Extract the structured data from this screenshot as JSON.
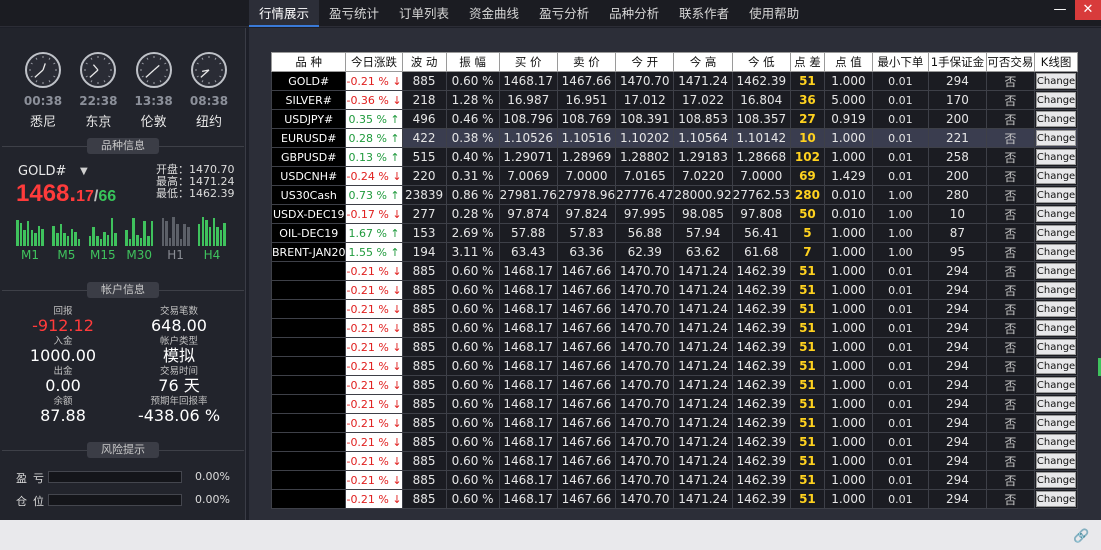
{
  "tabs": [
    {
      "label": "行情展示",
      "active": true
    },
    {
      "label": "盈亏统计"
    },
    {
      "label": "订单列表"
    },
    {
      "label": "资金曲线"
    },
    {
      "label": "盈亏分析"
    },
    {
      "label": "品种分析"
    },
    {
      "label": "联系作者"
    },
    {
      "label": "使用帮助"
    }
  ],
  "window": {
    "minimize": "—",
    "close": "✕"
  },
  "clocks": [
    {
      "time": "00:38",
      "city": "悉尼",
      "h": 0,
      "m": 38
    },
    {
      "time": "22:38",
      "city": "东京",
      "h": 22,
      "m": 38
    },
    {
      "time": "13:38",
      "city": "伦敦",
      "h": 13,
      "m": 38
    },
    {
      "time": "08:38",
      "city": "纽约",
      "h": 8,
      "m": 38
    }
  ],
  "sections": {
    "symbol_info": "品种信息",
    "account_info": "帐户信息",
    "risk": "风险提示"
  },
  "symbol": {
    "name": "GOLD#",
    "price_main": "1468.",
    "price_frac": "17",
    "price_sep": "/",
    "price_tail": "66",
    "open": "开盘：1470.70",
    "high": "最高：1471.24",
    "low": "最低：1462.39"
  },
  "timeframes": [
    {
      "label": "M1",
      "active": true
    },
    {
      "label": "M5",
      "active": true
    },
    {
      "label": "M15",
      "active": true
    },
    {
      "label": "M30",
      "active": true
    },
    {
      "label": "H1",
      "active": false
    },
    {
      "label": "H4",
      "active": true
    }
  ],
  "account": {
    "profit": {
      "label": "回报",
      "value": "-912.12"
    },
    "trades": {
      "label": "交易笔数",
      "value": "648.00"
    },
    "deposit": {
      "label": "入金",
      "value": "1000.00"
    },
    "acctype": {
      "label": "帐户类型",
      "value": "模拟"
    },
    "withdraw": {
      "label": "出金",
      "value": "0.00"
    },
    "tradetime": {
      "label": "交易时间",
      "value": "76 天"
    },
    "balance": {
      "label": "余额",
      "value": "87.88"
    },
    "annual": {
      "label": "预期年回报率",
      "value": "-438.06 %"
    }
  },
  "risk": [
    {
      "label": "盈亏",
      "value": "0.00%"
    },
    {
      "label": "仓位",
      "value": "0.00%"
    }
  ],
  "table": {
    "headers": [
      "品 种",
      "今日涨跌",
      "波 动",
      "振 幅",
      "买 价",
      "卖 价",
      "今 开",
      "今 高",
      "今 低",
      "点 差",
      "点 值",
      "最小下单",
      "1手保证金",
      "可否交易",
      "K线图"
    ],
    "button_label": "Change",
    "rows": [
      [
        "GOLD#",
        "-0.21 % ↓",
        "885",
        "0.60 %",
        "1468.17",
        "1467.66",
        "1470.70",
        "1471.24",
        "1462.39",
        "51",
        "1.000",
        "0.01",
        "294",
        "否"
      ],
      [
        "SILVER#",
        "-0.36 % ↓",
        "218",
        "1.28 %",
        "16.987",
        "16.951",
        "17.012",
        "17.022",
        "16.804",
        "36",
        "5.000",
        "0.01",
        "170",
        "否"
      ],
      [
        "USDJPY#",
        "0.35 % ↑",
        "496",
        "0.46 %",
        "108.796",
        "108.769",
        "108.391",
        "108.853",
        "108.357",
        "27",
        "0.919",
        "0.01",
        "200",
        "否"
      ],
      [
        "EURUSD#",
        "0.28 % ↑",
        "422",
        "0.38 %",
        "1.10526",
        "1.10516",
        "1.10202",
        "1.10564",
        "1.10142",
        "10",
        "1.000",
        "0.01",
        "221",
        "否"
      ],
      [
        "GBPUSD#",
        "0.13 % ↑",
        "515",
        "0.40 %",
        "1.29071",
        "1.28969",
        "1.28802",
        "1.29183",
        "1.28668",
        "102",
        "1.000",
        "0.01",
        "258",
        "否"
      ],
      [
        "USDCNH#",
        "-0.24 % ↓",
        "220",
        "0.31 %",
        "7.0069",
        "7.0000",
        "7.0165",
        "7.0220",
        "7.0000",
        "69",
        "1.429",
        "0.01",
        "200",
        "否"
      ],
      [
        "US30Cash",
        "0.73 % ↑",
        "23839",
        "0.86 %",
        "27981.76",
        "27978.96",
        "27776.47",
        "28000.92",
        "27762.53",
        "280",
        "0.010",
        "1.00",
        "280",
        "否"
      ],
      [
        "USDX-DEC19",
        "-0.17 % ↓",
        "277",
        "0.28 %",
        "97.874",
        "97.824",
        "97.995",
        "98.085",
        "97.808",
        "50",
        "0.010",
        "1.00",
        "10",
        "否"
      ],
      [
        "OIL-DEC19",
        "1.67 % ↑",
        "153",
        "2.69 %",
        "57.88",
        "57.83",
        "56.88",
        "57.94",
        "56.41",
        "5",
        "1.000",
        "1.00",
        "87",
        "否"
      ],
      [
        "BRENT-JAN20",
        "1.55 % ↑",
        "194",
        "3.11 %",
        "63.43",
        "63.36",
        "62.39",
        "63.62",
        "61.68",
        "7",
        "1.000",
        "1.00",
        "95",
        "否"
      ],
      [
        "",
        "-0.21 % ↓",
        "885",
        "0.60 %",
        "1468.17",
        "1467.66",
        "1470.70",
        "1471.24",
        "1462.39",
        "51",
        "1.000",
        "0.01",
        "294",
        "否"
      ],
      [
        "",
        "-0.21 % ↓",
        "885",
        "0.60 %",
        "1468.17",
        "1467.66",
        "1470.70",
        "1471.24",
        "1462.39",
        "51",
        "1.000",
        "0.01",
        "294",
        "否"
      ],
      [
        "",
        "-0.21 % ↓",
        "885",
        "0.60 %",
        "1468.17",
        "1467.66",
        "1470.70",
        "1471.24",
        "1462.39",
        "51",
        "1.000",
        "0.01",
        "294",
        "否"
      ],
      [
        "",
        "-0.21 % ↓",
        "885",
        "0.60 %",
        "1468.17",
        "1467.66",
        "1470.70",
        "1471.24",
        "1462.39",
        "51",
        "1.000",
        "0.01",
        "294",
        "否"
      ],
      [
        "",
        "-0.21 % ↓",
        "885",
        "0.60 %",
        "1468.17",
        "1467.66",
        "1470.70",
        "1471.24",
        "1462.39",
        "51",
        "1.000",
        "0.01",
        "294",
        "否"
      ],
      [
        "",
        "-0.21 % ↓",
        "885",
        "0.60 %",
        "1468.17",
        "1467.66",
        "1470.70",
        "1471.24",
        "1462.39",
        "51",
        "1.000",
        "0.01",
        "294",
        "否"
      ],
      [
        "",
        "-0.21 % ↓",
        "885",
        "0.60 %",
        "1468.17",
        "1467.66",
        "1470.70",
        "1471.24",
        "1462.39",
        "51",
        "1.000",
        "0.01",
        "294",
        "否"
      ],
      [
        "",
        "-0.21 % ↓",
        "885",
        "0.60 %",
        "1468.17",
        "1467.66",
        "1470.70",
        "1471.24",
        "1462.39",
        "51",
        "1.000",
        "0.01",
        "294",
        "否"
      ],
      [
        "",
        "-0.21 % ↓",
        "885",
        "0.60 %",
        "1468.17",
        "1467.66",
        "1470.70",
        "1471.24",
        "1462.39",
        "51",
        "1.000",
        "0.01",
        "294",
        "否"
      ],
      [
        "",
        "-0.21 % ↓",
        "885",
        "0.60 %",
        "1468.17",
        "1467.66",
        "1470.70",
        "1471.24",
        "1462.39",
        "51",
        "1.000",
        "0.01",
        "294",
        "否"
      ],
      [
        "",
        "-0.21 % ↓",
        "885",
        "0.60 %",
        "1468.17",
        "1467.66",
        "1470.70",
        "1471.24",
        "1462.39",
        "51",
        "1.000",
        "0.01",
        "294",
        "否"
      ],
      [
        "",
        "-0.21 % ↓",
        "885",
        "0.60 %",
        "1468.17",
        "1467.66",
        "1470.70",
        "1471.24",
        "1462.39",
        "51",
        "1.000",
        "0.01",
        "294",
        "否"
      ],
      [
        "",
        "-0.21 % ↓",
        "885",
        "0.60 %",
        "1468.17",
        "1467.66",
        "1470.70",
        "1471.24",
        "1462.39",
        "51",
        "1.000",
        "0.01",
        "294",
        "否"
      ]
    ],
    "highlight_row": 3
  },
  "colors": {
    "up": "#1f9a3c",
    "down": "#e0201f",
    "spread": "#ffd21f",
    "signal": "#3fc25d"
  }
}
